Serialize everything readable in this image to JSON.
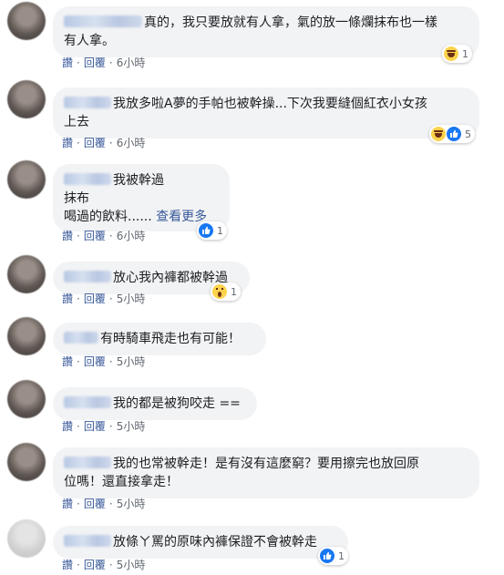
{
  "actions": {
    "like": "讚",
    "reply": "回覆",
    "separator": "·"
  },
  "more_label": "查看更多",
  "comments": [
    {
      "line1": "真的，我只要放就有人拿，氣的放一條爛抹布也一樣",
      "line2": "有人拿。",
      "time": "6小時",
      "reaction_count": "1",
      "reaction_icons": [
        "haha-icon"
      ]
    },
    {
      "line1": "我放多啦A夢的手帕也被幹操...下次我要縫個紅衣小女孩",
      "line2": "上去",
      "time": "6小時",
      "reaction_count": "5",
      "reaction_icons": [
        "haha-icon",
        "like-icon"
      ]
    },
    {
      "line1": "我被幹過",
      "line2": "抹布",
      "line3": "喝過的飲料......",
      "time": "6小時",
      "reaction_count": "1",
      "reaction_icons": [
        "like-icon"
      ]
    },
    {
      "line1": "放心我內褲都被幹過",
      "time": "5小時",
      "reaction_count": "1",
      "reaction_icons": [
        "wow-icon"
      ]
    },
    {
      "line1": "有時騎車飛走也有可能！",
      "time": "5小時"
    },
    {
      "line1": "我的都是被狗咬走 ==",
      "time": "5小時"
    },
    {
      "line1": "我的也常被幹走！是有沒有這麼窮？要用擦完也放回原",
      "line2": "位嗎！還直接拿走！",
      "time": "5小時"
    },
    {
      "line1": "放條ㄚ罵的原味內褲保證不會被幹走",
      "time": "5小時",
      "reaction_count": "1",
      "reaction_icons": [
        "like-icon"
      ]
    }
  ]
}
